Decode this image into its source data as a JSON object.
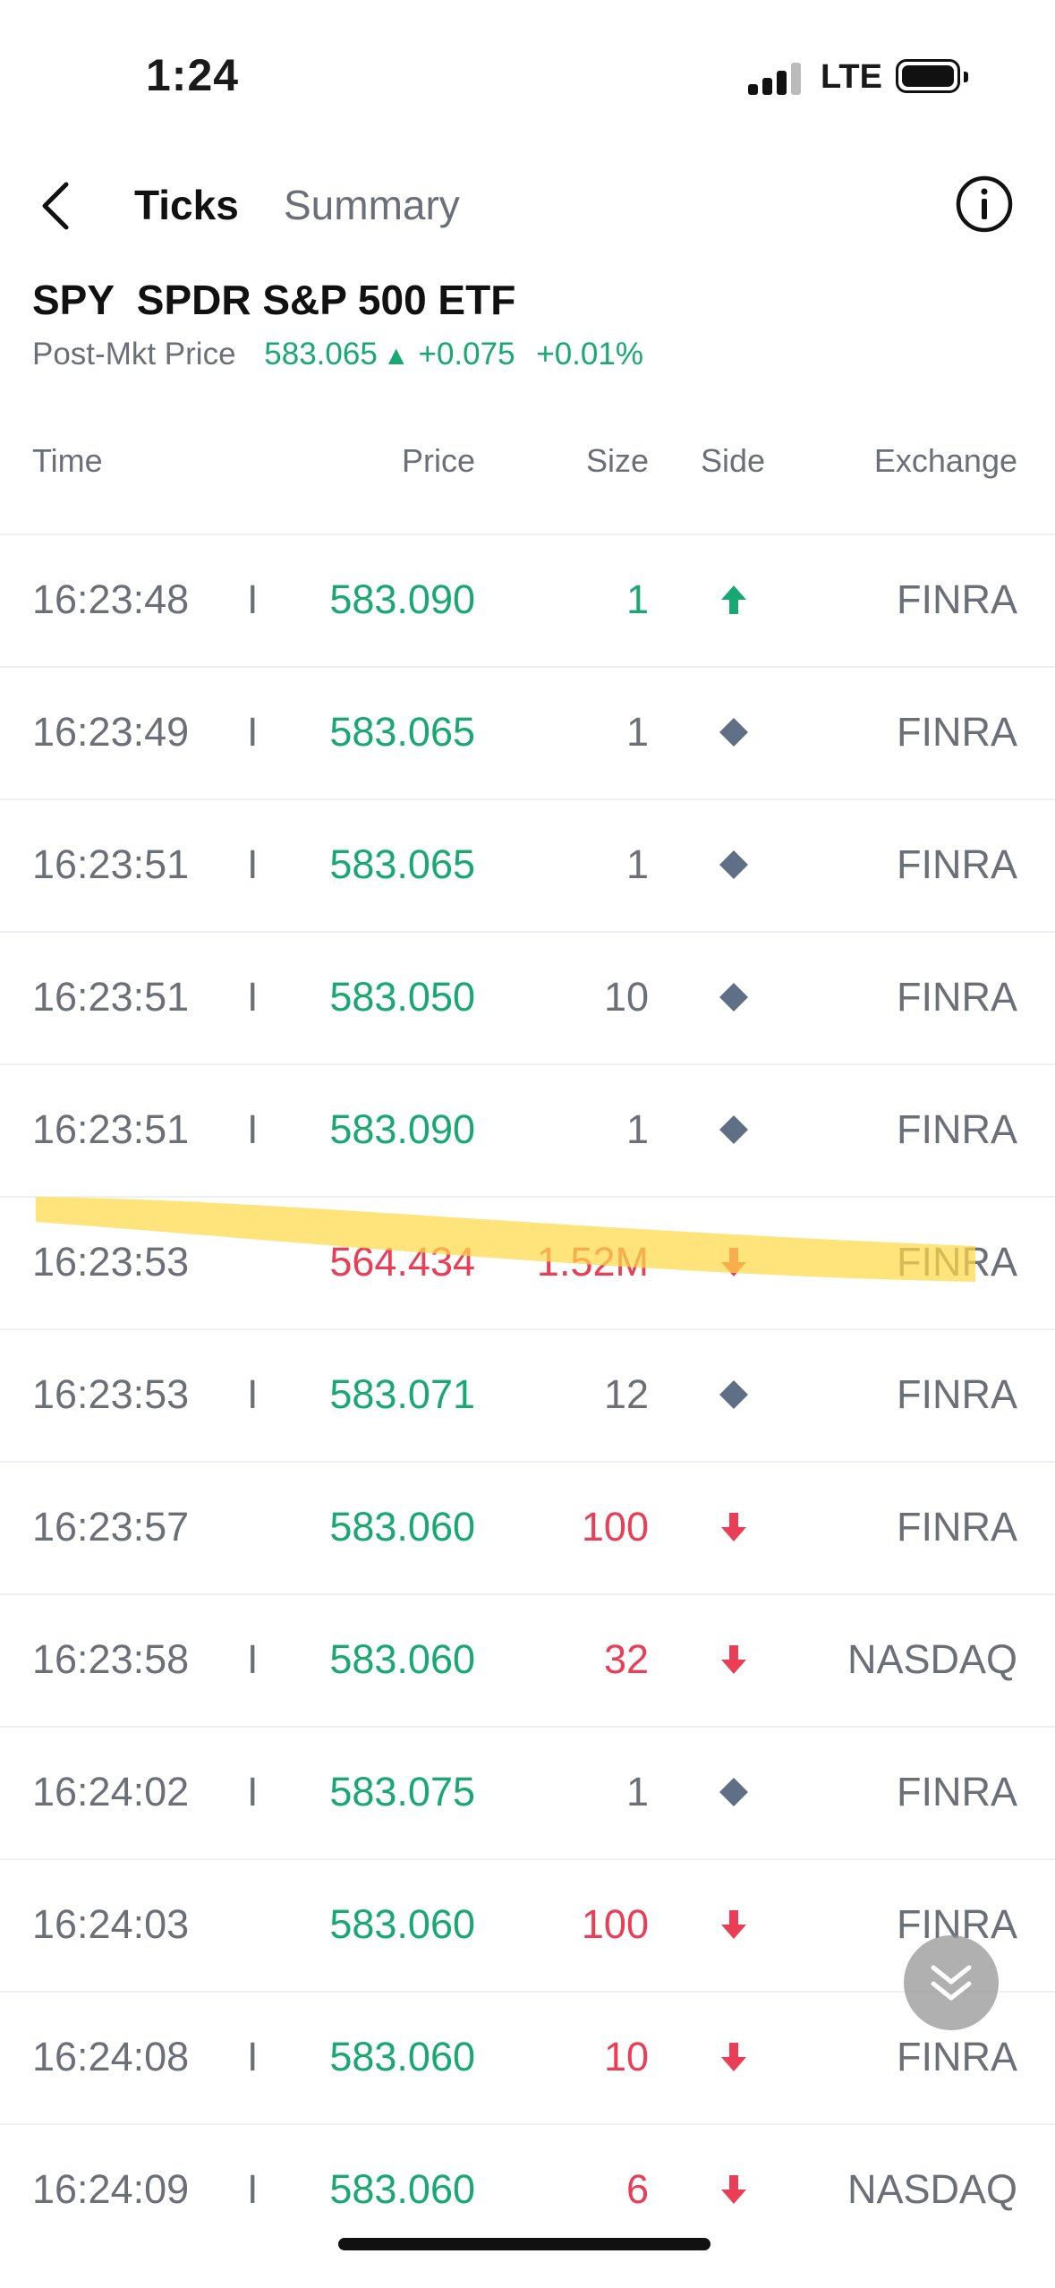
{
  "status": {
    "time": "1:24",
    "network": "LTE"
  },
  "nav": {
    "tabs": [
      "Ticks",
      "Summary"
    ]
  },
  "header": {
    "ticker": "SPY",
    "name": "SPDR S&P 500 ETF",
    "price_label": "Post-Mkt Price",
    "price": "583.065",
    "change": "+0.075",
    "change_pct": "+0.01%"
  },
  "table": {
    "columns": [
      "Time",
      "Price",
      "Size",
      "Side",
      "Exchange"
    ],
    "rows": [
      {
        "time": "16:23:48",
        "flag": "I",
        "price": "583.090",
        "price_color": "green",
        "size": "1",
        "size_color": "green",
        "side": "up",
        "exchange": "FINRA"
      },
      {
        "time": "16:23:49",
        "flag": "I",
        "price": "583.065",
        "price_color": "green",
        "size": "1",
        "size_color": "gray",
        "side": "neutral",
        "exchange": "FINRA"
      },
      {
        "time": "16:23:51",
        "flag": "I",
        "price": "583.065",
        "price_color": "green",
        "size": "1",
        "size_color": "gray",
        "side": "neutral",
        "exchange": "FINRA"
      },
      {
        "time": "16:23:51",
        "flag": "I",
        "price": "583.050",
        "price_color": "green",
        "size": "10",
        "size_color": "gray",
        "side": "neutral",
        "exchange": "FINRA"
      },
      {
        "time": "16:23:51",
        "flag": "I",
        "price": "583.090",
        "price_color": "green",
        "size": "1",
        "size_color": "gray",
        "side": "neutral",
        "exchange": "FINRA"
      },
      {
        "time": "16:23:53",
        "flag": "",
        "price": "564.434",
        "price_color": "red",
        "size": "1.52M",
        "size_color": "red",
        "side": "down",
        "exchange": "FINRA"
      },
      {
        "time": "16:23:53",
        "flag": "I",
        "price": "583.071",
        "price_color": "green",
        "size": "12",
        "size_color": "gray",
        "side": "neutral",
        "exchange": "FINRA"
      },
      {
        "time": "16:23:57",
        "flag": "",
        "price": "583.060",
        "price_color": "green",
        "size": "100",
        "size_color": "red",
        "side": "down",
        "exchange": "FINRA"
      },
      {
        "time": "16:23:58",
        "flag": "I",
        "price": "583.060",
        "price_color": "green",
        "size": "32",
        "size_color": "red",
        "side": "down",
        "exchange": "NASDAQ"
      },
      {
        "time": "16:24:02",
        "flag": "I",
        "price": "583.075",
        "price_color": "green",
        "size": "1",
        "size_color": "gray",
        "side": "neutral",
        "exchange": "FINRA"
      },
      {
        "time": "16:24:03",
        "flag": "",
        "price": "583.060",
        "price_color": "green",
        "size": "100",
        "size_color": "red",
        "side": "down",
        "exchange": "FINRA"
      },
      {
        "time": "16:24:08",
        "flag": "I",
        "price": "583.060",
        "price_color": "green",
        "size": "10",
        "size_color": "red",
        "side": "down",
        "exchange": "FINRA"
      },
      {
        "time": "16:24:09",
        "flag": "I",
        "price": "583.060",
        "price_color": "green",
        "size": "6",
        "size_color": "red",
        "side": "down",
        "exchange": "NASDAQ"
      }
    ]
  },
  "colors": {
    "up": "#19a872",
    "down": "#ea3d56",
    "neutral": "#5f6f86",
    "highlight": "#ffd94a"
  },
  "icons": {
    "back": "chevron-left-icon",
    "info": "info-icon",
    "scroll": "double-chevron-down-icon"
  }
}
